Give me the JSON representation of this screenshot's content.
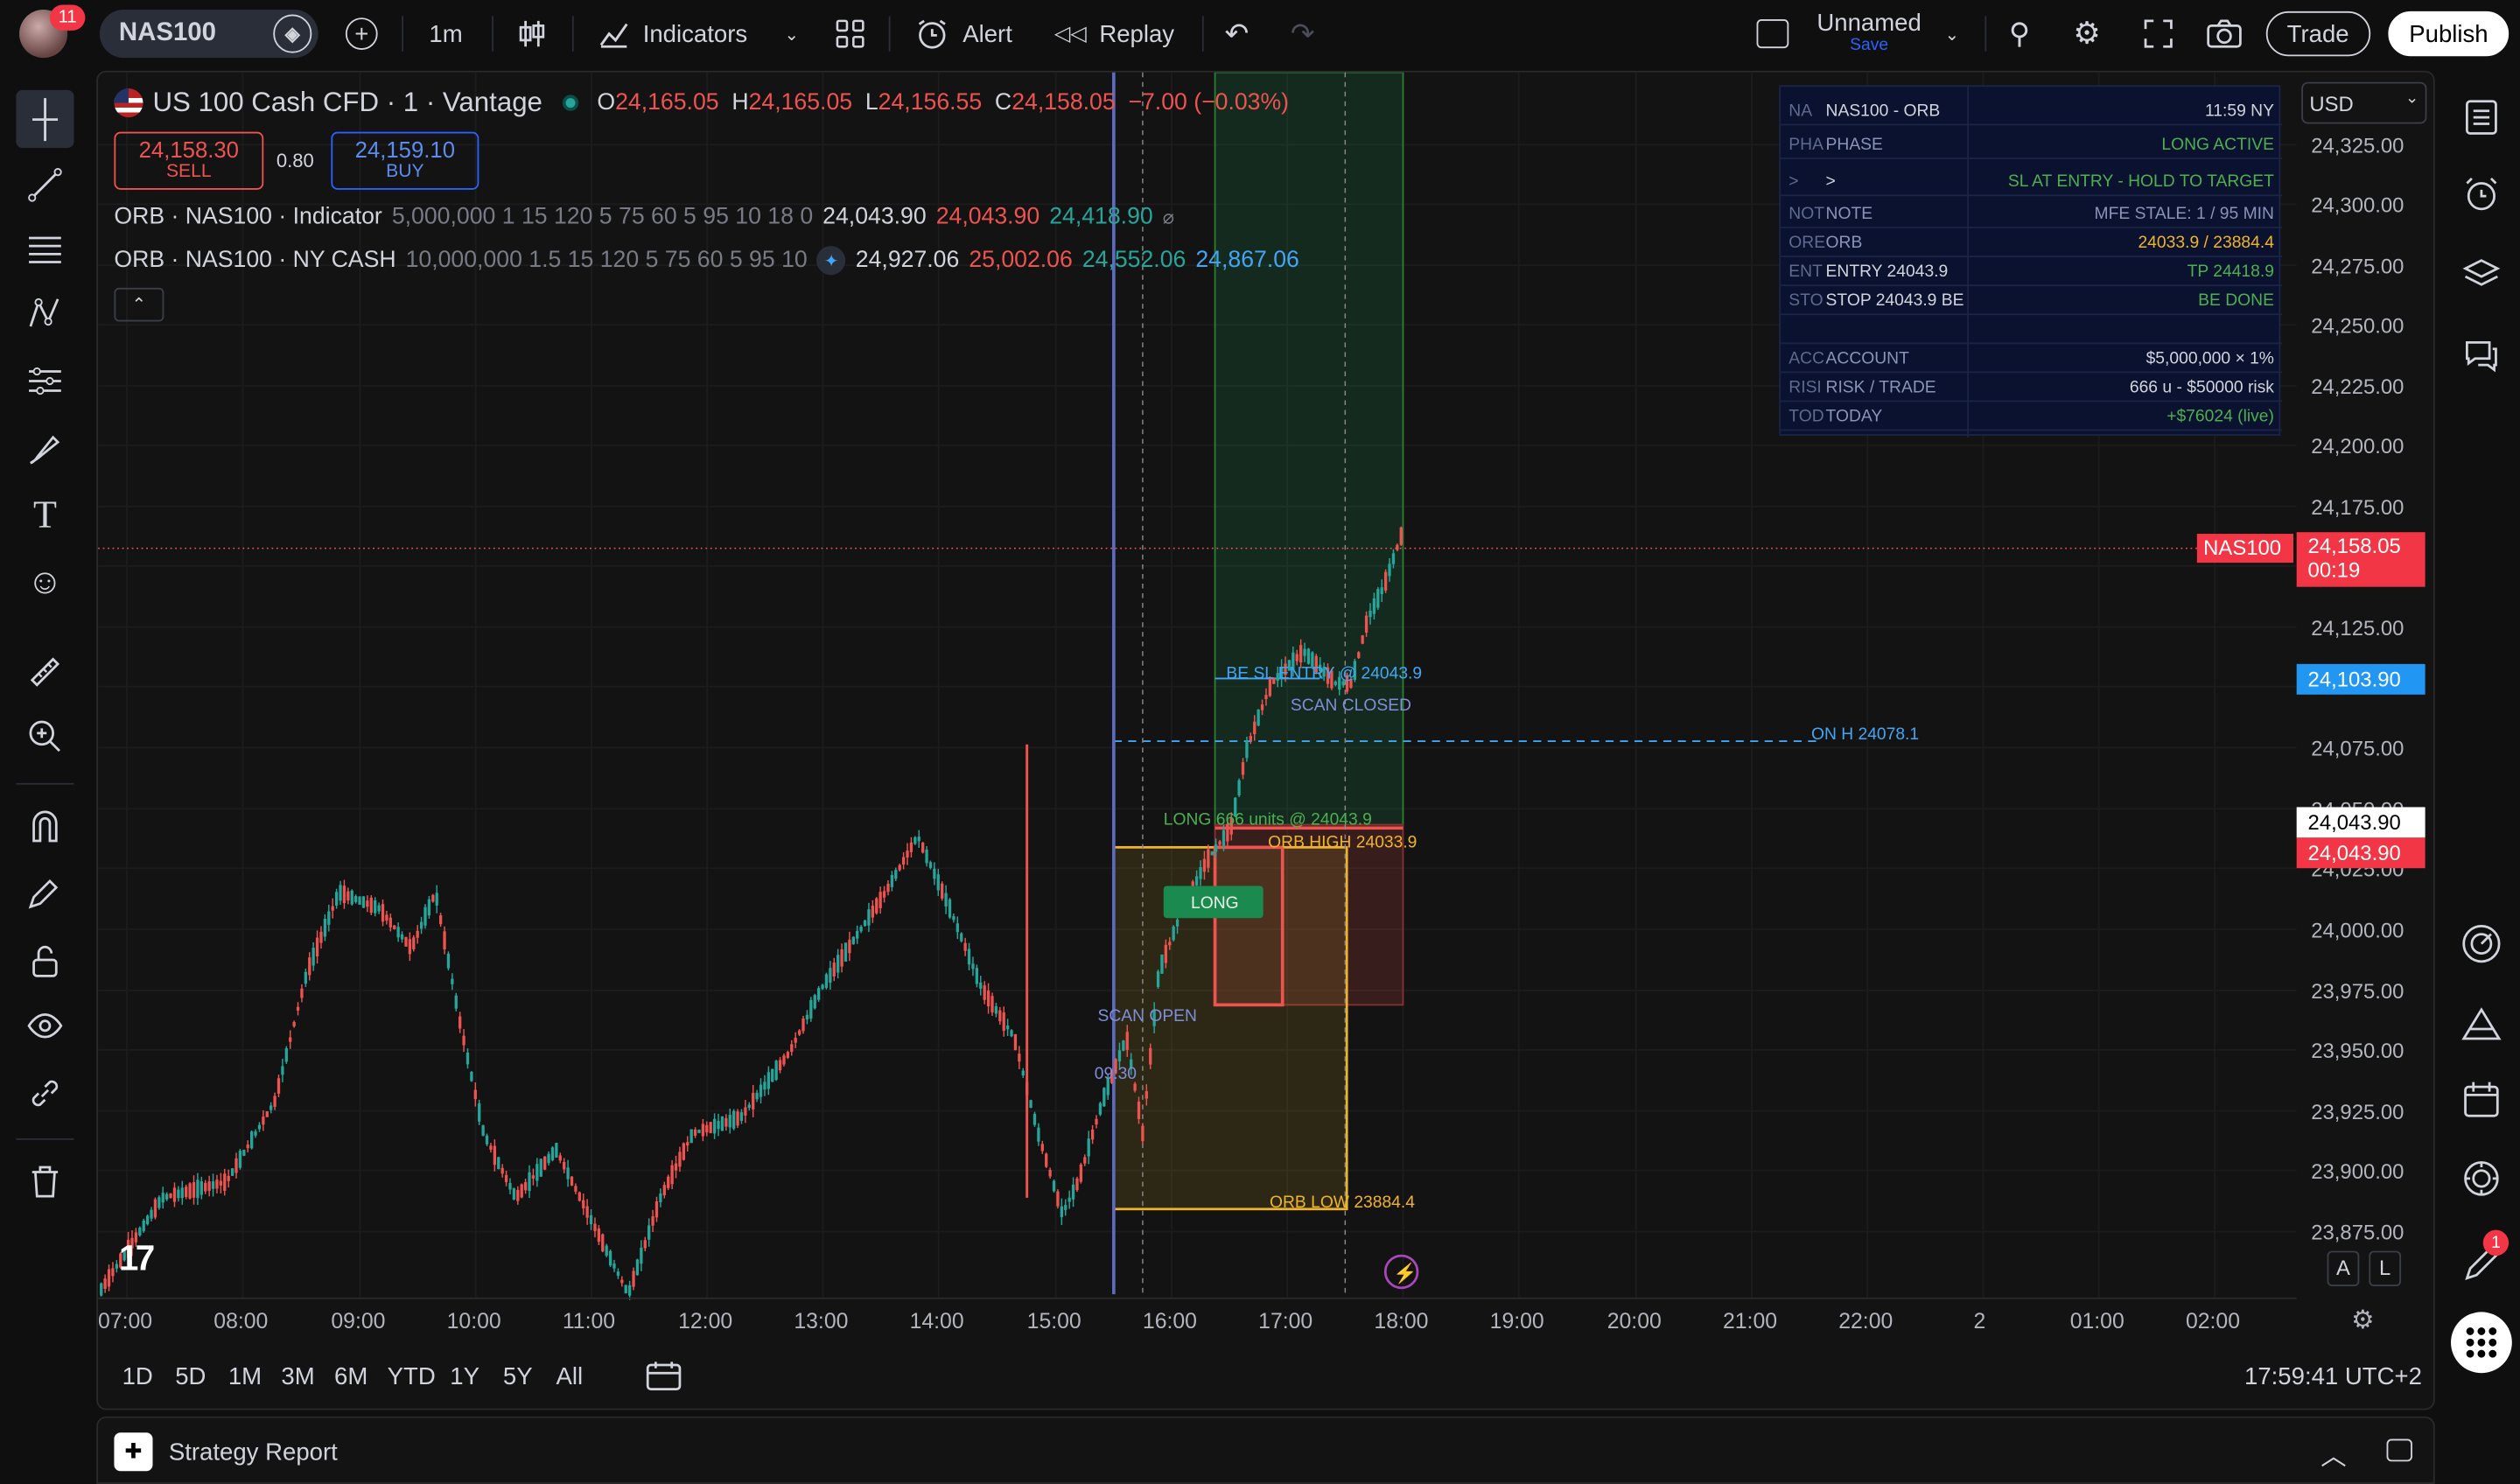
{
  "topbar": {
    "notif_count": "11",
    "symbol": "NAS100",
    "interval": "1m",
    "indicators": "Indicators",
    "alert": "Alert",
    "replay": "Replay",
    "layout_name": "Unnamed",
    "layout_save": "Save",
    "trade": "Trade",
    "publish": "Publish"
  },
  "legend": {
    "title": "US 100 Cash CFD · 1 · Vantage",
    "o_label": "O",
    "o": "24,165.05",
    "h_label": "H",
    "h": "24,165.05",
    "l_label": "L",
    "l": "24,156.55",
    "c_label": "C",
    "c": "24,158.05",
    "change": "−7.00 (−0.03%)",
    "sell_price": "24,158.30",
    "sell": "SELL",
    "spread": "0.80",
    "buy_price": "24,159.10",
    "buy": "BUY",
    "ind1_name": "ORB · NAS100 · Indicator",
    "ind1_params": "5,000,000 1 15 120 5 75 60 5 95 10 18 0",
    "ind1_v1": "24,043.90",
    "ind1_v2": "24,043.90",
    "ind1_v3": "24,418.90",
    "ind2_name": "ORB · NAS100 · NY CASH",
    "ind2_params": "10,000,000 1.5 15 120 5 75 60 5 95 10",
    "ind2_v1": "24,927.06",
    "ind2_v2": "25,002.06",
    "ind2_v3": "24,552.06",
    "ind2_v4": "24,867.06"
  },
  "panel": {
    "rows": [
      {
        "a": "NA",
        "b": "NAS100  -  ORB",
        "c": "11:59 NY",
        "color": "#d1d4dc",
        "ccolor": "#d1d4dc"
      },
      {
        "a": "PHA",
        "b": "PHASE",
        "c": "LONG ACTIVE",
        "color": "#8a93b8",
        "ccolor": "#4caf50"
      },
      {
        "a": ">",
        "b": ">",
        "c": "SL AT ENTRY  -  HOLD TO TARGET",
        "color": "#d1d4dc",
        "ccolor": "#4caf50"
      },
      {
        "a": "NOT",
        "b": "NOTE",
        "c": "MFE STALE: 1 / 95 MIN",
        "color": "#8a93b8",
        "ccolor": "#8a93b8"
      },
      {
        "a": "ORE",
        "b": "ORB",
        "c": "24033.9  /  23884.4",
        "color": "#8a93b8",
        "ccolor": "#f0b429"
      },
      {
        "a": "ENT",
        "b": "ENTRY  24043.9",
        "c": "TP  24418.9",
        "color": "#d1d4dc",
        "ccolor": "#4caf50"
      },
      {
        "a": "STO",
        "b": "STOP  24043.9  BE",
        "c": "BE  DONE",
        "color": "#d1d4dc",
        "ccolor": "#4caf50"
      },
      {
        "a": "",
        "b": "",
        "c": "",
        "color": "#8a93b8",
        "ccolor": "#8a93b8"
      },
      {
        "a": "ACC",
        "b": "ACCOUNT",
        "c": "$5,000,000  ×  1%",
        "color": "#8a93b8",
        "ccolor": "#d1d4dc"
      },
      {
        "a": "RISI",
        "b": "RISK / TRADE",
        "c": "666 u  -  $50000 risk",
        "color": "#8a93b8",
        "ccolor": "#d1d4dc"
      },
      {
        "a": "TOD",
        "b": "TODAY",
        "c": "+$76024 (live)",
        "color": "#8a93b8",
        "ccolor": "#4caf50"
      }
    ]
  },
  "price_axis": {
    "currency": "USD",
    "ticks": [
      "24,325.00",
      "24,300.00",
      "24,275.00",
      "24,250.00",
      "24,225.00",
      "24,200.00",
      "24,175.00",
      "24,125.00",
      "24,075.00",
      "24,050.00",
      "24,025.00",
      "24,000.00",
      "23,975.00",
      "23,950.00",
      "23,925.00",
      "23,900.00",
      "23,875.00"
    ],
    "current_symbol": "NAS100",
    "current_price": "24,158.05",
    "countdown": "00:19",
    "crosshair_price": "24,103.90",
    "label_a": "24,043.90",
    "label_b": "24,043.90"
  },
  "time_axis": {
    "ticks": [
      "07:00",
      "08:00",
      "09:00",
      "10:00",
      "11:00",
      "12:00",
      "13:00",
      "14:00",
      "15:00",
      "16:00",
      "17:00",
      "18:00",
      "19:00",
      "20:00",
      "21:00",
      "22:00",
      "2",
      "01:00",
      "02:00"
    ]
  },
  "annotations": {
    "be_sl": "BE  SL  ENTRY @ 24043.9",
    "scan_closed": "SCAN CLOSED",
    "on_h": "ON H  24078.1",
    "long_units": "LONG 666 units @ 24043.9",
    "orb_high": "ORB HIGH  24033.9",
    "long_badge": "LONG",
    "scan_open": "SCAN OPEN",
    "time_0930": "09:30",
    "orb_low": "ORB LOW  23884.4",
    "scale_a": "A",
    "scale_l": "L"
  },
  "bottombar": {
    "ranges": [
      "1D",
      "5D",
      "1M",
      "3M",
      "6M",
      "YTD",
      "1Y",
      "5Y",
      "All"
    ],
    "clock": "17:59:41 UTC+2"
  },
  "footer": {
    "title": "Strategy Report"
  },
  "right_badge": "1",
  "colors": {
    "up": "#26a69a",
    "down": "#ef5350",
    "accent": "#2962ff",
    "orb": "#f0b429"
  }
}
